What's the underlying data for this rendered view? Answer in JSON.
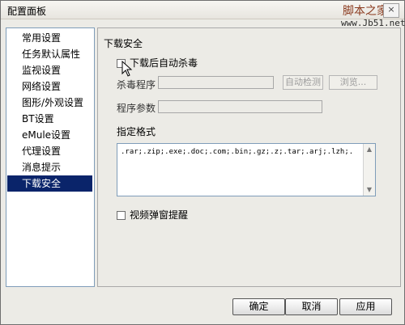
{
  "window": {
    "title": "配置面板",
    "close_symbol": "×"
  },
  "watermark": {
    "line1": "脚本之家",
    "line2": "www.Jb51.net"
  },
  "sidebar": {
    "items": [
      {
        "label": "常用设置"
      },
      {
        "label": "任务默认属性"
      },
      {
        "label": "监视设置"
      },
      {
        "label": "网络设置"
      },
      {
        "label": "图形/外观设置"
      },
      {
        "label": "BT设置"
      },
      {
        "label": "eMule设置"
      },
      {
        "label": "代理设置"
      },
      {
        "label": "消息提示"
      },
      {
        "label": "下载安全",
        "selected": true
      }
    ]
  },
  "security": {
    "heading": "下载安全",
    "auto_scan_label": "下载后自动杀毒",
    "antivirus_program_label": "杀毒程序",
    "program_params_label": "程序参数",
    "auto_detect_button": "自动检测",
    "browse_button": "浏览...",
    "specified_format_label": "指定格式",
    "formats_text": ".rar;.zip;.exe;.doc;.com;.bin;.gz;.z;.tar;.arj;.lzh;.",
    "video_popup_label": "视频弹窗提醒"
  },
  "footer": {
    "ok": "确定",
    "cancel": "取消",
    "apply": "应用"
  }
}
